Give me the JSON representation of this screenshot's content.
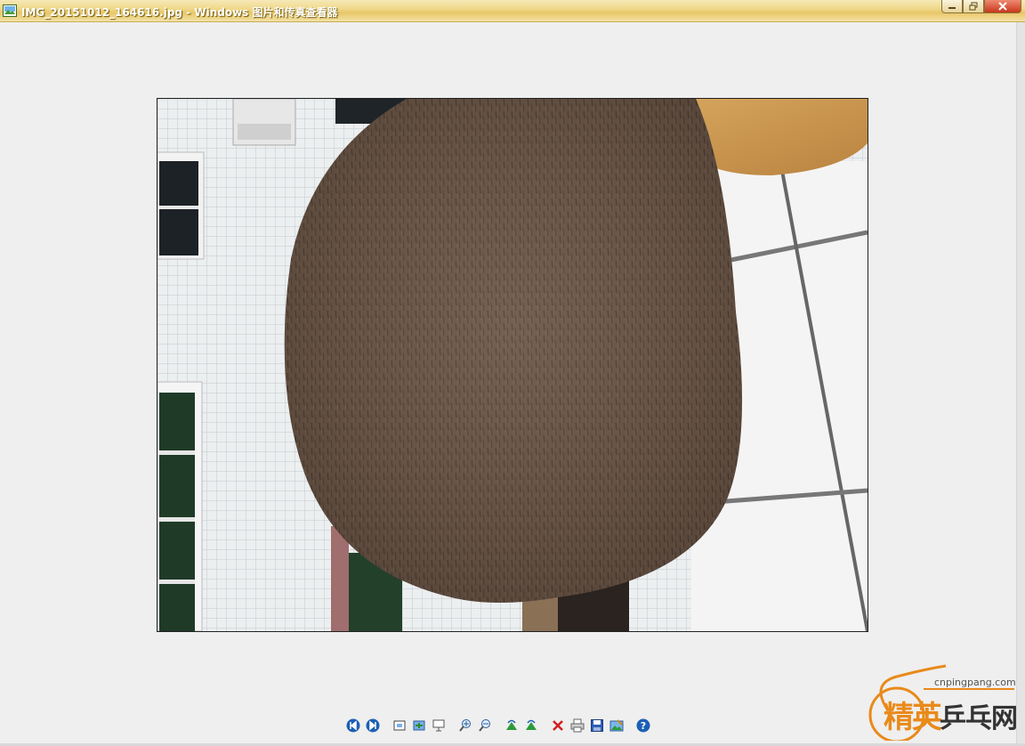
{
  "window": {
    "title": "IMG_20151012_164616.jpg - Windows 图片和传真查看器"
  },
  "toolbar": {
    "buttons": [
      {
        "name": "previous-image",
        "icon": "prev-circle-icon"
      },
      {
        "name": "next-image",
        "icon": "next-circle-icon"
      },
      {
        "name": "best-fit",
        "icon": "best-fit-icon"
      },
      {
        "name": "actual-size",
        "icon": "actual-size-icon"
      },
      {
        "name": "slide-show",
        "icon": "slideshow-icon"
      },
      {
        "name": "zoom-in",
        "icon": "zoom-in-icon"
      },
      {
        "name": "zoom-out",
        "icon": "zoom-out-icon"
      },
      {
        "name": "rotate-clockwise",
        "icon": "rotate-cw-icon"
      },
      {
        "name": "rotate-counterclockwise",
        "icon": "rotate-ccw-icon"
      },
      {
        "name": "delete",
        "icon": "delete-icon"
      },
      {
        "name": "print",
        "icon": "print-icon"
      },
      {
        "name": "save-copy",
        "icon": "save-icon"
      },
      {
        "name": "edit",
        "icon": "edit-icon"
      },
      {
        "name": "help",
        "icon": "help-icon"
      }
    ]
  },
  "watermark": {
    "url": "cnpingpang.com",
    "brand_a": "精英",
    "brand_b": "乒乓网"
  },
  "colors": {
    "title_bar": "#f0d98a",
    "background": "#efefef",
    "nav_blue": "#1d5fb5",
    "delete_red": "#d21f1f",
    "watermark_orange": "#e98a1a"
  }
}
